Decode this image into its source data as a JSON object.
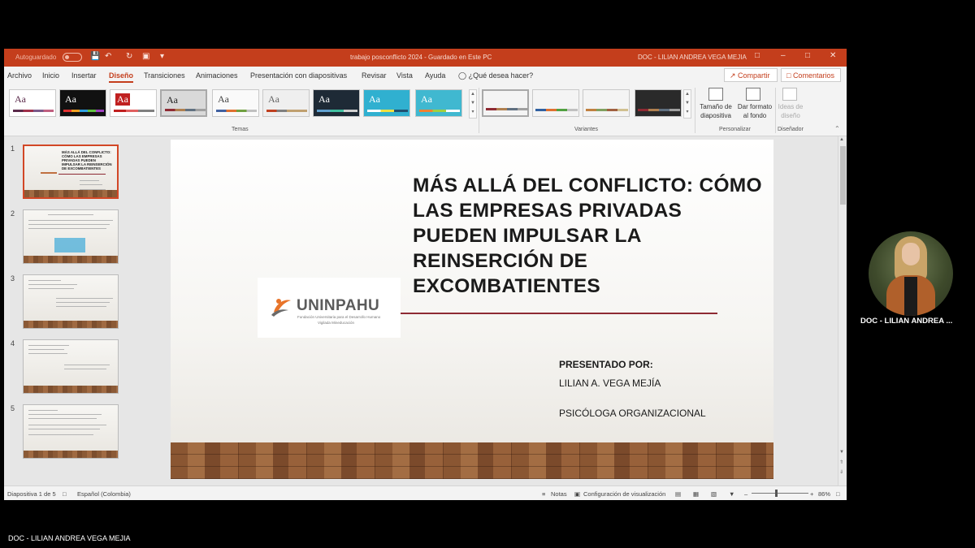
{
  "window": {
    "autosave_label": "Autoguardado",
    "title": "trabajo posconflicto 2024  -  Guardado en Este PC",
    "user": "DOC - LILIAN ANDREA VEGA MEJIA"
  },
  "tabs": [
    "Archivo",
    "Inicio",
    "Insertar",
    "Diseño",
    "Transiciones",
    "Animaciones",
    "Presentación con diapositivas",
    "Revisar",
    "Vista",
    "Ayuda"
  ],
  "active_tab": "Diseño",
  "tell_me": "¿Qué desea hacer?",
  "share_label": "Compartir",
  "comments_label": "Comentarios",
  "ribbon": {
    "themes_label": "Temas",
    "variants_label": "Variantes",
    "customize_label": "Personalizar",
    "designer_label": "Diseñador",
    "slide_size": "Tamaño de diapositiva",
    "format_bg": "Dar formato al fondo",
    "design_ideas": "Ideas de diseño",
    "theme_glyph": "Aa"
  },
  "slides_count": 5,
  "slide": {
    "title": "MÁS ALLÁ DEL CONFLICTO: CÓMO LAS EMPRESAS PRIVADAS PUEDEN IMPULSAR LA REINSERCIÓN DE EXCOMBATIENTES",
    "logo_name": "UNINPAHU",
    "logo_tagline1": "Fundación Universitaria para el Desarrollo Humano",
    "logo_tagline2": "Vigilada Mineducación",
    "presented_by": "PRESENTADO POR:",
    "presenter": "LILIAN A. VEGA MEJÍA",
    "role": "PSICÓLOGA ORGANIZACIONAL"
  },
  "thumbs": {
    "slide1_title": "MÁS ALLÁ DEL CONFLICTO: CÓMO LAS EMPRESAS PRIVADAS PUEDEN IMPULSAR LA REINSERCIÓN DE EXCOMBATIENTES"
  },
  "status": {
    "slide_info": "Diapositiva 1 de 5",
    "language": "Español (Colombia)",
    "notes": "Notas",
    "view_settings": "Configuración de visualización",
    "zoom": "86%"
  },
  "participant": {
    "tile_label": "DOC - LILIAN ANDREA ...",
    "bottom_label": "DOC - LILIAN ANDREA VEGA MEJIA"
  },
  "colors": {
    "accent": "#c43e1c",
    "title_rule": "#8e2a33"
  }
}
